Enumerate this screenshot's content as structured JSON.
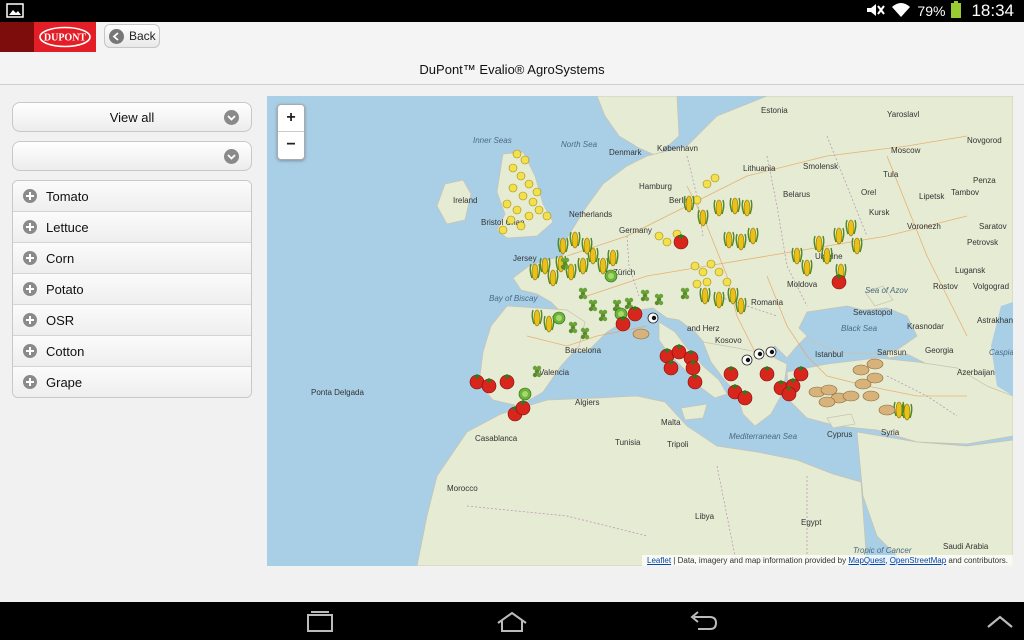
{
  "status_bar": {
    "battery": "79%",
    "time": "18:34",
    "icons": [
      "image-icon",
      "mute-icon",
      "wifi-icon",
      "battery-icon"
    ]
  },
  "header": {
    "logo_text": "DUPONT",
    "back_label": "Back",
    "title": "DuPont™ Evalio® AgroSystems"
  },
  "sidebar": {
    "select_primary": "View all",
    "select_secondary": "",
    "items": [
      {
        "label": "Tomato"
      },
      {
        "label": "Lettuce"
      },
      {
        "label": "Corn"
      },
      {
        "label": "Potato"
      },
      {
        "label": "OSR"
      },
      {
        "label": "Cotton"
      },
      {
        "label": "Grape"
      }
    ]
  },
  "map": {
    "zoom_in": "+",
    "zoom_out": "−",
    "attribution": {
      "leaflet": "Leaflet",
      "text": " | Data, imagery and map information provided by ",
      "mapquest": "MapQuest",
      "sep": ", ",
      "osm": "OpenStreetMap",
      "end": " and contributors."
    },
    "labels": {
      "inner_seas": "Inner Seas",
      "north_sea": "North Sea",
      "ireland": "Ireland",
      "bristol": "Bristol Chan",
      "denmark": "Denmark",
      "kobenhavn": "København",
      "hamburg": "Hamburg",
      "berlin": "Berlin",
      "netherlands": "Netherlands",
      "germany": "Germany",
      "lithuania": "Lithuania",
      "belarus": "Belarus",
      "moscow": "Moscow",
      "estonia": "Estonia",
      "jersey": "Jersey",
      "bay_of_biscay": "Bay of Biscay",
      "romania": "Romania",
      "moldova": "Moldova",
      "sea_of_azov": "Sea of Azov",
      "sevastopol": "Sevastopol",
      "black_sea": "Black Sea",
      "istanbul": "Istanbul",
      "samsun": "Samsun",
      "georgia": "Georgia",
      "azerbaijan": "Azerbaijan",
      "caspian": "Caspia",
      "kosovo": "Kosovo",
      "bosnia": "and Herz",
      "zurich": "Zürich",
      "barcelona": "Barcelona",
      "valencia": "Valencia",
      "ponta_delgada": "Ponta Delgada",
      "algiers": "Algiers",
      "casablanca": "Casablanca",
      "morocco": "Morocco",
      "tunisia": "Tunisia",
      "tripoli": "Tripoli",
      "malta": "Malta",
      "med_sea": "Mediterranean Sea",
      "libya": "Libya",
      "egypt": "Egypt",
      "cyprus": "Cyprus",
      "syria": "Syria",
      "saudi": "Saudi Arabia",
      "tropic": "Tropic of Cancer",
      "lugansk": "Lugansk",
      "rostov": "Rostov",
      "novgorod": "Novgorod",
      "yaroslavl": "Yaroslavl",
      "smolensk": "Smolensk",
      "tula": "Tula",
      "orel": "Orel",
      "kursk": "Kursk",
      "lipetsk": "Lipetsk",
      "tambov": "Tambov",
      "voronezh": "Voronezh",
      "saratov": "Saratov",
      "penza": "Penza",
      "petrovsk": "Petrovsk",
      "volgograd": "Volgograd",
      "krasnodar": "Krasnodar",
      "astrakhan": "Astrakhan",
      "ukraine": "Ukraine"
    }
  },
  "nav_bar": {
    "icons": [
      "recent-apps-icon",
      "home-icon",
      "back-nav-icon",
      "chevron-up-icon"
    ]
  },
  "colors": {
    "brand_red": "#e41e26",
    "brand_dark": "#7d0d0d",
    "sea": "#a9cfe6",
    "land": "#e8ecd6"
  }
}
